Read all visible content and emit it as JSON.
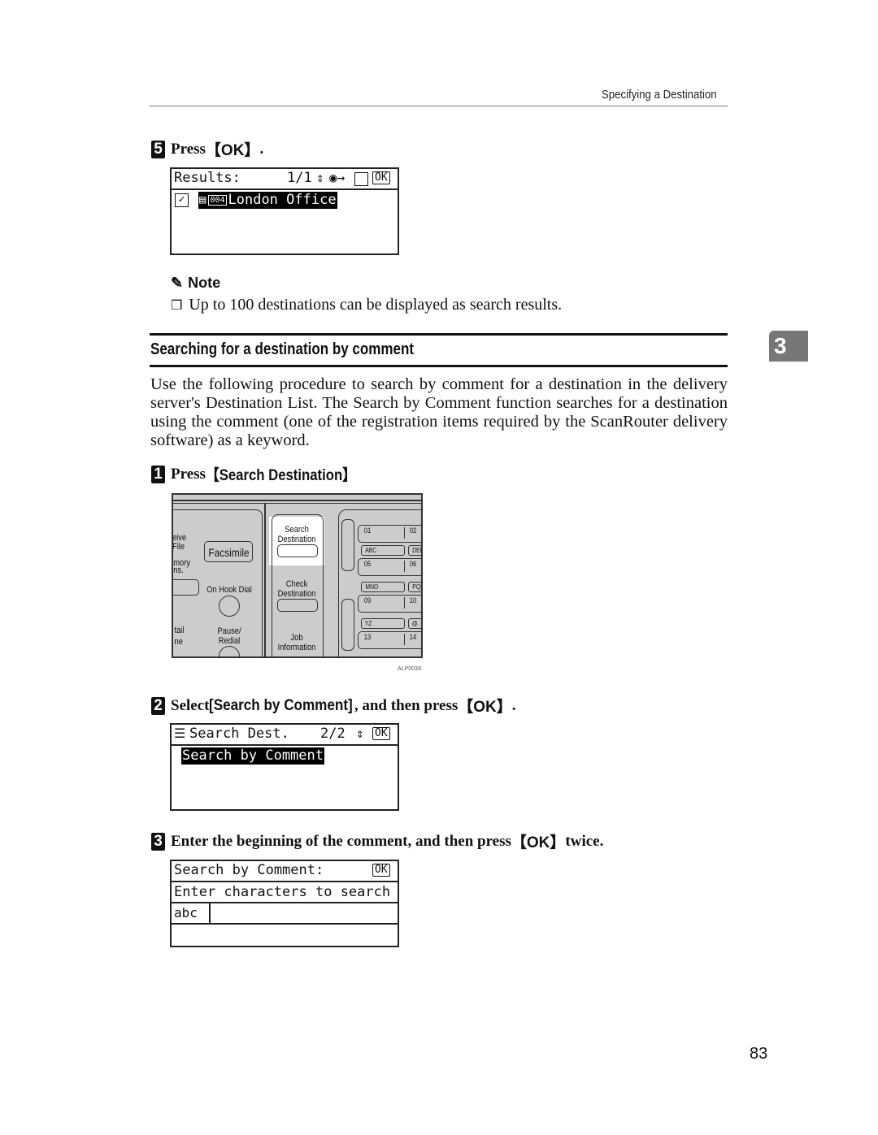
{
  "header": {
    "section_title": "Specifying a Destination"
  },
  "step5": {
    "number": "5",
    "text_prefix": "Press ",
    "key": "【OK】",
    "text_suffix": ".",
    "lcd": {
      "title": "Results:",
      "page": "1/1",
      "ok": "OK",
      "item_number": "004",
      "item_name": "London Office"
    }
  },
  "note": {
    "title": "Note",
    "items": [
      "Up to 100 destinations can be displayed as search results."
    ]
  },
  "section": {
    "title": "Searching for a destination by comment",
    "chapter_tab": "3",
    "intro": "Use the following procedure to search by comment for a destination in the delivery server's Destination List. The Search by Comment function searches for a destination using the comment (one of the registration items required by the ScanRouter delivery software) as a keyword."
  },
  "steps": [
    {
      "number": "1",
      "text_prefix": "Press ",
      "key": "【Search Destination】",
      "text_suffix": ".",
      "panel": {
        "labels": {
          "receive_file": "eive File",
          "facsimile": "Facsimile",
          "memory": "mory\nns.",
          "on_hook_dial": "On Hook Dial",
          "detail": "tail\nne",
          "pause_redial": "Pause/\nRedial",
          "search_destination": "Search\nDestination",
          "check_destination": "Check\nDestination",
          "job_information": "Job\nInformation"
        },
        "keys": [
          "01",
          "02",
          "ABC",
          "DEF",
          "05",
          "06",
          "MNO",
          "PQR",
          "09",
          "10",
          "YZ",
          "@.",
          "13",
          "14"
        ],
        "figure_id": "ALP003S"
      }
    },
    {
      "number": "2",
      "text_prefix": "Select ",
      "key": "[Search by Comment]",
      "text_mid": ", and then press ",
      "key2": "【OK】",
      "text_suffix": ".",
      "lcd": {
        "title": "Search Dest.",
        "page": "2/2",
        "ok": "OK",
        "selected": "Search by Comment"
      }
    },
    {
      "number": "3",
      "text_prefix": "Enter the beginning of the comment, and then press ",
      "key": "【OK】",
      "text_suffix": " twice.",
      "lcd": {
        "title": "Search by Comment:",
        "ok": "OK",
        "prompt": "Enter characters to search",
        "mode": "abc",
        "input_value": ""
      }
    }
  ],
  "page_number": "83"
}
